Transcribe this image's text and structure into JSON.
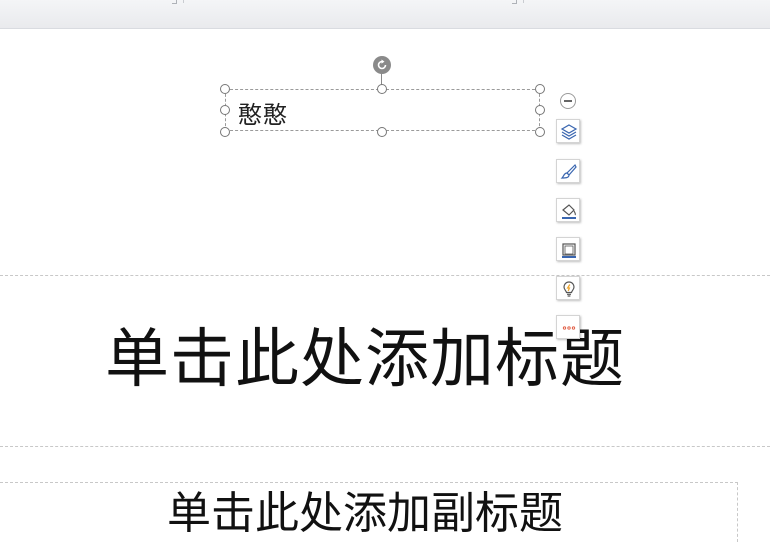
{
  "textbox": {
    "text": "憨憨"
  },
  "title_placeholder": {
    "text": "单击此处添加标题"
  },
  "subtitle_placeholder": {
    "text": "单击此处添加副标题"
  },
  "floating_toolbar": {
    "items": [
      {
        "icon": "layers-icon"
      },
      {
        "icon": "brush-icon"
      },
      {
        "icon": "fill-bucket-icon"
      },
      {
        "icon": "outline-frame-icon"
      },
      {
        "icon": "lightbulb-icon"
      },
      {
        "icon": "more-icon"
      }
    ],
    "accent": "#f0a830",
    "icon_color": "#3a66b0"
  }
}
